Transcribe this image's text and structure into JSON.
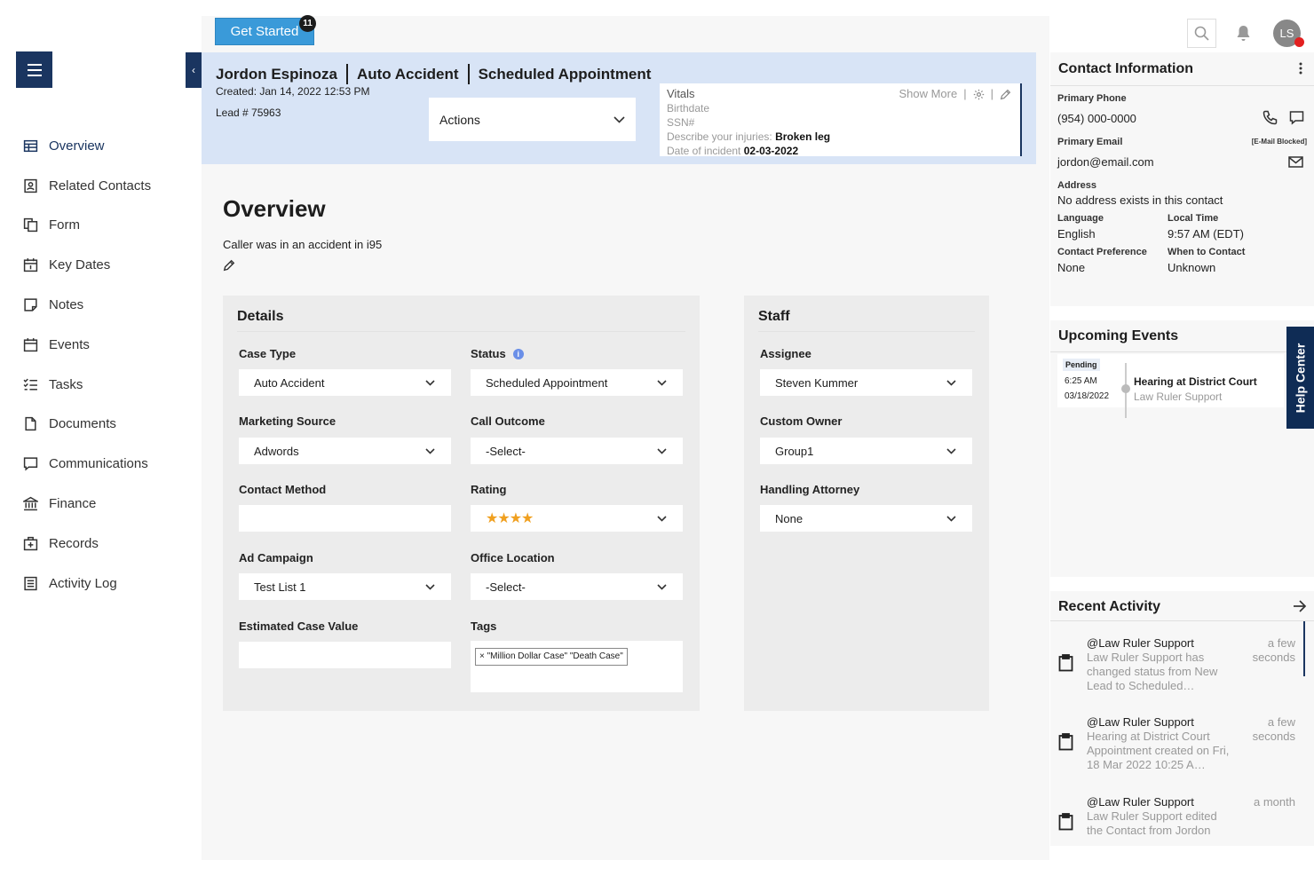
{
  "get_started": {
    "label": "Get Started",
    "badge": "11"
  },
  "sidebar": {
    "items": [
      {
        "label": "Overview",
        "icon": "table-icon"
      },
      {
        "label": "Related Contacts",
        "icon": "contact-card-icon"
      },
      {
        "label": "Form",
        "icon": "copy-icon"
      },
      {
        "label": "Key Dates",
        "icon": "calendar-date-icon"
      },
      {
        "label": "Notes",
        "icon": "note-icon"
      },
      {
        "label": "Events",
        "icon": "calendar-icon"
      },
      {
        "label": "Tasks",
        "icon": "checklist-icon"
      },
      {
        "label": "Documents",
        "icon": "document-icon"
      },
      {
        "label": "Communications",
        "icon": "chat-icon"
      },
      {
        "label": "Finance",
        "icon": "bank-icon"
      },
      {
        "label": "Records",
        "icon": "medical-case-icon"
      },
      {
        "label": "Activity Log",
        "icon": "log-icon"
      }
    ]
  },
  "header": {
    "name": "Jordon Espinoza",
    "case_type": "Auto Accident",
    "status": "Scheduled Appointment",
    "created": "Created: Jan 14, 2022 12:53 PM",
    "lead": "Lead # 75963",
    "actions_label": "Actions"
  },
  "vitals": {
    "title": "Vitals",
    "show_more": "Show More",
    "birthdate_label": "Birthdate",
    "ssn_label": "SSN#",
    "injuries_label": "Describe your injuries:",
    "injuries_value": "Broken leg",
    "incident_label": "Date of incident",
    "incident_value": "02-03-2022"
  },
  "overview": {
    "title": "Overview",
    "description": "Caller was in an accident in i95"
  },
  "details": {
    "title": "Details",
    "case_type_label": "Case Type",
    "case_type_value": "Auto Accident",
    "status_label": "Status",
    "status_value": "Scheduled Appointment",
    "marketing_source_label": "Marketing Source",
    "marketing_source_value": "Adwords",
    "call_outcome_label": "Call Outcome",
    "call_outcome_value": "-Select-",
    "contact_method_label": "Contact Method",
    "rating_label": "Rating",
    "rating_value": "★★★★",
    "ad_campaign_label": "Ad Campaign",
    "ad_campaign_value": "Test List 1",
    "office_location_label": "Office Location",
    "office_location_value": "-Select-",
    "estimated_value_label": "Estimated Case Value",
    "tags_label": "Tags",
    "tag_value": "× \"Million Dollar Case\" \"Death Case\""
  },
  "staff": {
    "title": "Staff",
    "assignee_label": "Assignee",
    "assignee_value": "Steven Kummer",
    "custom_owner_label": "Custom Owner",
    "custom_owner_value": "Group1",
    "attorney_label": "Handling Attorney",
    "attorney_value": "None"
  },
  "topbar": {
    "avatar_initials": "LS"
  },
  "contact": {
    "title": "Contact Information",
    "phone_label": "Primary Phone",
    "phone_value": "(954) 000-0000",
    "email_label": "Primary Email",
    "email_blocked": "[E-Mail Blocked]",
    "email_value": "jordon@email.com",
    "address_label": "Address",
    "address_value": "No address exists in this contact",
    "language_label": "Language",
    "language_value": "English",
    "local_time_label": "Local Time",
    "local_time_value": "9:57 AM (EDT)",
    "pref_label": "Contact Preference",
    "pref_value": "None",
    "when_label": "When to Contact",
    "when_value": "Unknown"
  },
  "events": {
    "title": "Upcoming Events",
    "items": [
      {
        "badge": "Pending",
        "time": "6:25 AM",
        "date": "03/18/2022",
        "title": "Hearing at District Court",
        "by": "Law Ruler Support"
      }
    ]
  },
  "activity": {
    "title": "Recent Activity",
    "items": [
      {
        "user": "@Law Ruler Support",
        "desc": "Law Ruler Support has changed status from New Lead to Scheduled…",
        "time": "a few seconds"
      },
      {
        "user": "@Law Ruler Support",
        "desc": "Hearing at District Court Appointment created on Fri, 18 Mar 2022 10:25 A…",
        "time": "a few seconds"
      },
      {
        "user": "@Law Ruler Support",
        "desc": "Law Ruler Support edited the Contact from Jordon",
        "time": "a month"
      }
    ]
  },
  "help_center": {
    "label": "Help Center"
  },
  "colors": {
    "navy": "#1a3560",
    "header_bg": "#d8e4f6",
    "accent": "#3a9ad9",
    "star": "#f0a020",
    "alert": "#e32020"
  }
}
